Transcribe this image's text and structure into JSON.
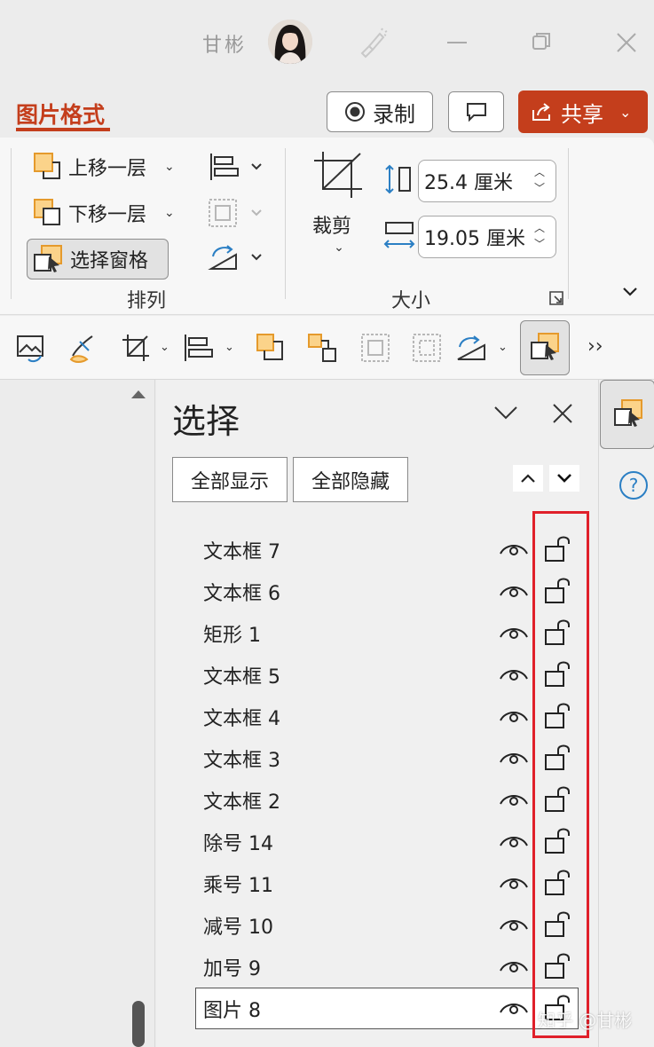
{
  "titlebar": {
    "user_name": "甘彬"
  },
  "ribbon_tabs": {
    "active": "图片格式"
  },
  "actions": {
    "record_label": "录制",
    "share_label": "共享"
  },
  "ribbon": {
    "arrange_group": {
      "label": "排列",
      "bring_forward": "上移一层",
      "send_backward": "下移一层",
      "selection_pane": "选择窗格"
    },
    "size_group": {
      "label": "大小",
      "crop_label": "裁剪",
      "height_value": "25.4 厘米",
      "width_value": "19.05 厘米"
    }
  },
  "selection_pane": {
    "title": "选择",
    "show_all": "全部显示",
    "hide_all": "全部隐藏",
    "items": [
      {
        "label": "文本框 7"
      },
      {
        "label": "文本框 6"
      },
      {
        "label": "矩形 1"
      },
      {
        "label": "文本框 5"
      },
      {
        "label": "文本框 4"
      },
      {
        "label": "文本框 3"
      },
      {
        "label": "文本框 2"
      },
      {
        "label": "除号 14"
      },
      {
        "label": "乘号 11"
      },
      {
        "label": "减号 10"
      },
      {
        "label": "加号 9"
      },
      {
        "label": "图片 8"
      }
    ],
    "selected_index": 11
  },
  "watermark": "知乎 @甘彬",
  "colors": {
    "accent": "#c43e1c",
    "highlight": "#e0202a",
    "icon_orange": "#f0a030",
    "icon_blue": "#2b7fc4"
  },
  "icons": [
    "avatar",
    "brush-icon",
    "minimize-icon",
    "restore-icon",
    "close-icon",
    "record-icon",
    "comment-icon",
    "share-icon",
    "eye-icon",
    "unlock-icon",
    "help-icon"
  ]
}
